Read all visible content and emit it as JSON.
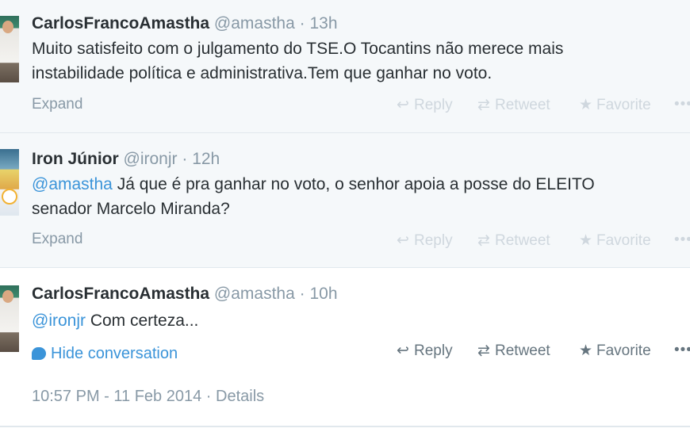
{
  "icons": {
    "reply": "reply-icon",
    "retweet": "retweet-icon",
    "favorite": "star-icon",
    "more": "more-dots-icon",
    "conversation": "speech-bubble-icon"
  },
  "colors": {
    "link": "#3b94d9",
    "muted": "#8899a6",
    "collapsed_bg": "#f5f8fa"
  },
  "tweets": [
    {
      "name": "CarlosFrancoAmastha",
      "handle": "@amastha",
      "sep": "·",
      "time": "13h",
      "text_line1": "Muito satisfeito com o julgamento do TSE.O Tocantins não merece mais",
      "text_line2": "instabilidade política e administrativa.Tem que ganhar no voto.",
      "expand": "Expand",
      "reply": "Reply",
      "retweet": "Retweet",
      "favorite": "Favorite",
      "more": "•••"
    },
    {
      "name": "Iron Júnior",
      "handle": "@ironjr",
      "sep": "·",
      "time": "12h",
      "mention": "@amastha",
      "text_line1": " Já que é pra ganhar no voto, o senhor apoia a posse do ELEITO",
      "text_line2": "senador Marcelo Miranda?",
      "expand": "Expand",
      "reply": "Reply",
      "retweet": "Retweet",
      "favorite": "Favorite",
      "more": "•••"
    },
    {
      "name": "CarlosFrancoAmastha",
      "handle": "@amastha",
      "sep": "·",
      "time": "10h",
      "mention": "@ironjr",
      "text_line1": " Com certeza...",
      "hide_conversation": "Hide conversation",
      "reply": "Reply",
      "retweet": "Retweet",
      "favorite": "Favorite",
      "more": "•••",
      "timestamp": "10:57 PM - 11 Feb 2014",
      "details_sep": " · ",
      "details": "Details"
    }
  ]
}
